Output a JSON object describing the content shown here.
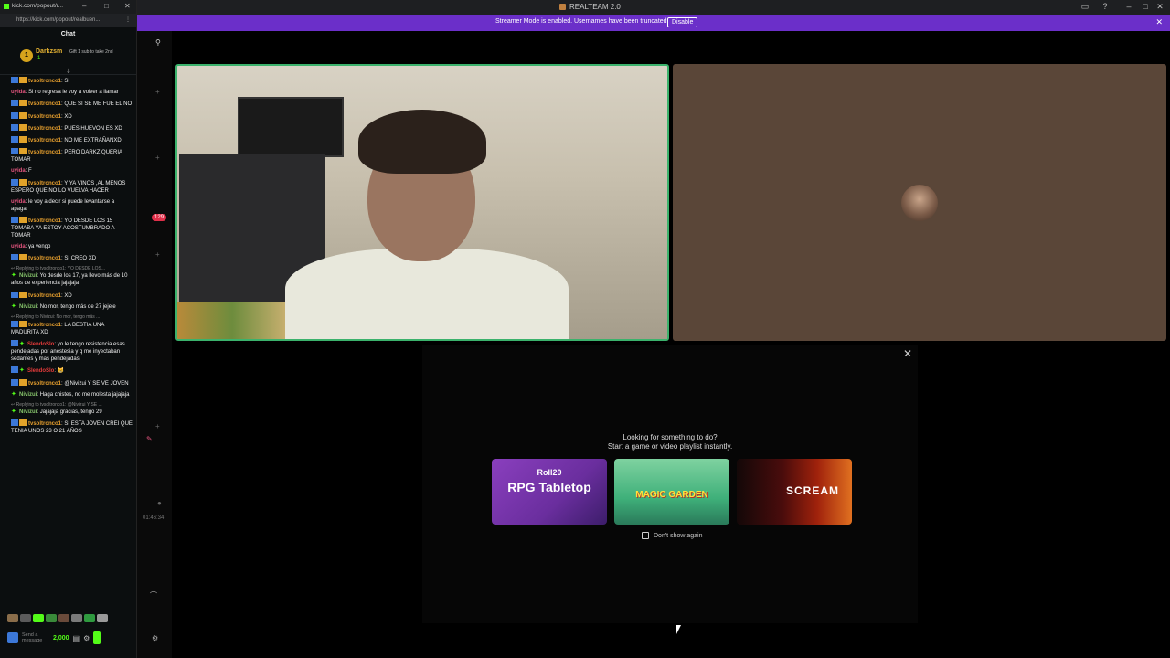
{
  "main_window": {
    "title": "REALTEAM 2.0",
    "streamer_bar": {
      "message": "Streamer Mode is enabled. Usernames have been truncated.",
      "disable_label": "Disable"
    },
    "rail": {
      "badge": "129",
      "time": "01:46:34"
    }
  },
  "activity_panel": {
    "title_line1": "Looking for something to do?",
    "title_line2": "Start a game or video playlist instantly.",
    "cards": [
      {
        "brand": "Roll20",
        "title": "RPG Tabletop"
      },
      {
        "title": "MAGIC GARDEN"
      },
      {
        "title": "SCREAM"
      }
    ],
    "dont_show_label": "Don't show again"
  },
  "kick_window": {
    "tab_title": "kick.com/popout/r...",
    "url": "https://kick.com/popout/realbuen...",
    "chat_title": "Chat",
    "pinned": {
      "rank": "1",
      "name": "Darkzsm",
      "sub": "1",
      "gift_text": "Gift 1 sub to take 2nd"
    },
    "messages": [
      {
        "user": "tvsoltronco1",
        "color": "orange",
        "badges": 2,
        "text": "SI"
      },
      {
        "user": "uyida",
        "color": "pink",
        "badges": 0,
        "text": "Si no regresa le voy a volver a llamar"
      },
      {
        "user": "tvsoltronco1",
        "color": "orange",
        "badges": 2,
        "text": "QUE SI SE ME FUE EL NO"
      },
      {
        "user": "tvsoltronco1",
        "color": "orange",
        "badges": 2,
        "text": "XD"
      },
      {
        "user": "tvsoltronco1",
        "color": "orange",
        "badges": 2,
        "text": "PUES HUEVON ES XD"
      },
      {
        "user": "tvsoltronco1",
        "color": "orange",
        "badges": 2,
        "text": "NO ME EXTRAÑANXD"
      },
      {
        "user": "tvsoltronco1",
        "color": "orange",
        "badges": 2,
        "text": "PERO DARKZ QUERIA TOMAR"
      },
      {
        "user": "uyida",
        "color": "pink",
        "badges": 0,
        "text": "F"
      },
      {
        "user": "tvsoltronco1",
        "color": "orange",
        "badges": 2,
        "text": "Y YA VINOS ,AL MENOS ESPERO QUE NO LO VUELVA HACER"
      },
      {
        "user": "uyida",
        "color": "pink",
        "badges": 0,
        "text": "le voy a decir si puede levantarse a apagar"
      },
      {
        "user": "tvsoltronco1",
        "color": "orange",
        "badges": 2,
        "text": "YO DESDE LOS 15 TOMABA YA ESTOY ACOSTUMBRADO A TOMAR"
      },
      {
        "user": "uyida",
        "color": "pink",
        "badges": 0,
        "text": "ya vengo"
      },
      {
        "user": "tvsoltronco1",
        "color": "orange",
        "badges": 2,
        "text": "SI CREO XD"
      },
      {
        "reply": "Replying to tvsoltronco1: YO DESDE LOS...",
        "user": "Nivizui",
        "color": "green",
        "badges": 1,
        "text": "Yo desde los 17, ya llevo más de 10 años de experiencia jajajaja"
      },
      {
        "user": "tvsoltronco1",
        "color": "orange",
        "badges": 2,
        "text": "XD"
      },
      {
        "user": "Nivizui",
        "color": "green",
        "badges": 1,
        "text": "No mor, tengo más de 27 jejeje"
      },
      {
        "reply": "Replying to Nivizui: No mor, tengo más ...",
        "user": "tvsoltronco1",
        "color": "orange",
        "badges": 2,
        "text": "LA BESTIA UNA MADURITA XD"
      },
      {
        "user": "SlendoSlo",
        "color": "red",
        "badges": 3,
        "text": "yo le tengo resistencia esas pendejadas por anestesia y q me inyectaban sedantes y mas pendejadas"
      },
      {
        "user": "SlendoSlo",
        "color": "red",
        "badges": 3,
        "text": "😸"
      },
      {
        "user": "tvsoltronco1",
        "color": "orange",
        "badges": 2,
        "text": "@Nivizui Y SE VE JOVEN"
      },
      {
        "user": "Nivizui",
        "color": "green",
        "badges": 1,
        "text": "Haga chistes, no me molesta jajajaja"
      },
      {
        "reply": "Replying to tvsoltronco1: @Nivizui Y SE ...",
        "user": "Nivizui",
        "color": "green",
        "badges": 1,
        "text": "Jajajaja gracias, tengo 29"
      },
      {
        "user": "tvsoltronco1",
        "color": "orange",
        "badges": 2,
        "text": "SI ESTA JOVEN CREI QUE TENIA UNOS 23 O 21 AÑOS"
      }
    ],
    "footer": {
      "send_placeholder": "Send a message",
      "points": "2,000"
    }
  },
  "colors": {
    "streamer_bar": "#6b2fc9",
    "kick_green": "#53fc18",
    "speaking_border": "#3bb26c"
  }
}
